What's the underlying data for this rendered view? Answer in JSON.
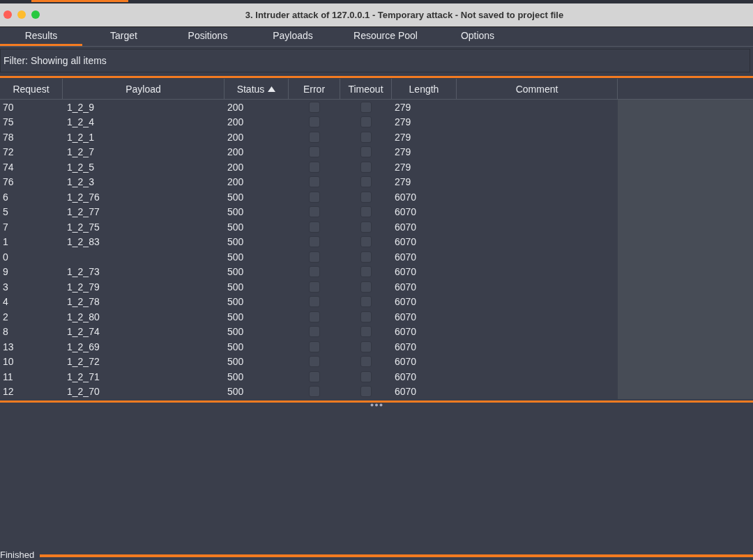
{
  "window": {
    "title": "3. Intruder attack of 127.0.0.1 - Temporary attack - Not saved to project file"
  },
  "tabs": [
    {
      "label": "Results",
      "selected": true
    },
    {
      "label": "Target",
      "selected": false
    },
    {
      "label": "Positions",
      "selected": false
    },
    {
      "label": "Payloads",
      "selected": false
    },
    {
      "label": "Resource Pool",
      "selected": false
    },
    {
      "label": "Options",
      "selected": false
    }
  ],
  "filter": "Filter: Showing all items",
  "table": {
    "columns": [
      {
        "label": "Request",
        "sorted": false
      },
      {
        "label": "Payload",
        "sorted": false
      },
      {
        "label": "Status",
        "sorted": true
      },
      {
        "label": "Error",
        "sorted": false
      },
      {
        "label": "Timeout",
        "sorted": false
      },
      {
        "label": "Length",
        "sorted": false
      },
      {
        "label": "Comment",
        "sorted": false
      }
    ],
    "rows": [
      {
        "request": "70",
        "payload": "1_2_9",
        "status": "200",
        "error": false,
        "timeout": false,
        "length": "279"
      },
      {
        "request": "75",
        "payload": "1_2_4",
        "status": "200",
        "error": false,
        "timeout": false,
        "length": "279"
      },
      {
        "request": "78",
        "payload": "1_2_1",
        "status": "200",
        "error": false,
        "timeout": false,
        "length": "279"
      },
      {
        "request": "72",
        "payload": "1_2_7",
        "status": "200",
        "error": false,
        "timeout": false,
        "length": "279"
      },
      {
        "request": "74",
        "payload": "1_2_5",
        "status": "200",
        "error": false,
        "timeout": false,
        "length": "279"
      },
      {
        "request": "76",
        "payload": "1_2_3",
        "status": "200",
        "error": false,
        "timeout": false,
        "length": "279"
      },
      {
        "request": "6",
        "payload": "1_2_76",
        "status": "500",
        "error": false,
        "timeout": false,
        "length": "6070"
      },
      {
        "request": "5",
        "payload": "1_2_77",
        "status": "500",
        "error": false,
        "timeout": false,
        "length": "6070"
      },
      {
        "request": "7",
        "payload": "1_2_75",
        "status": "500",
        "error": false,
        "timeout": false,
        "length": "6070"
      },
      {
        "request": "1",
        "payload": "1_2_83",
        "status": "500",
        "error": false,
        "timeout": false,
        "length": "6070"
      },
      {
        "request": "0",
        "status": "500",
        "error": false,
        "timeout": false,
        "length": "6070"
      },
      {
        "request": "9",
        "payload": "1_2_73",
        "status": "500",
        "error": false,
        "timeout": false,
        "length": "6070"
      },
      {
        "request": "3",
        "payload": "1_2_79",
        "status": "500",
        "error": false,
        "timeout": false,
        "length": "6070"
      },
      {
        "request": "4",
        "payload": "1_2_78",
        "status": "500",
        "error": false,
        "timeout": false,
        "length": "6070"
      },
      {
        "request": "2",
        "payload": "1_2_80",
        "status": "500",
        "error": false,
        "timeout": false,
        "length": "6070"
      },
      {
        "request": "8",
        "payload": "1_2_74",
        "status": "500",
        "error": false,
        "timeout": false,
        "length": "6070"
      },
      {
        "request": "13",
        "payload": "1_2_69",
        "status": "500",
        "error": false,
        "timeout": false,
        "length": "6070"
      },
      {
        "request": "10",
        "payload": "1_2_72",
        "status": "500",
        "error": false,
        "timeout": false,
        "length": "6070"
      },
      {
        "request": "11",
        "payload": "1_2_71",
        "status": "500",
        "error": false,
        "timeout": false,
        "length": "6070"
      },
      {
        "request": "12",
        "payload": "1_2_70",
        "status": "500",
        "error": false,
        "timeout": false,
        "length": "6070"
      }
    ]
  },
  "status_bar": {
    "text": "Finished",
    "level": 1
  }
}
